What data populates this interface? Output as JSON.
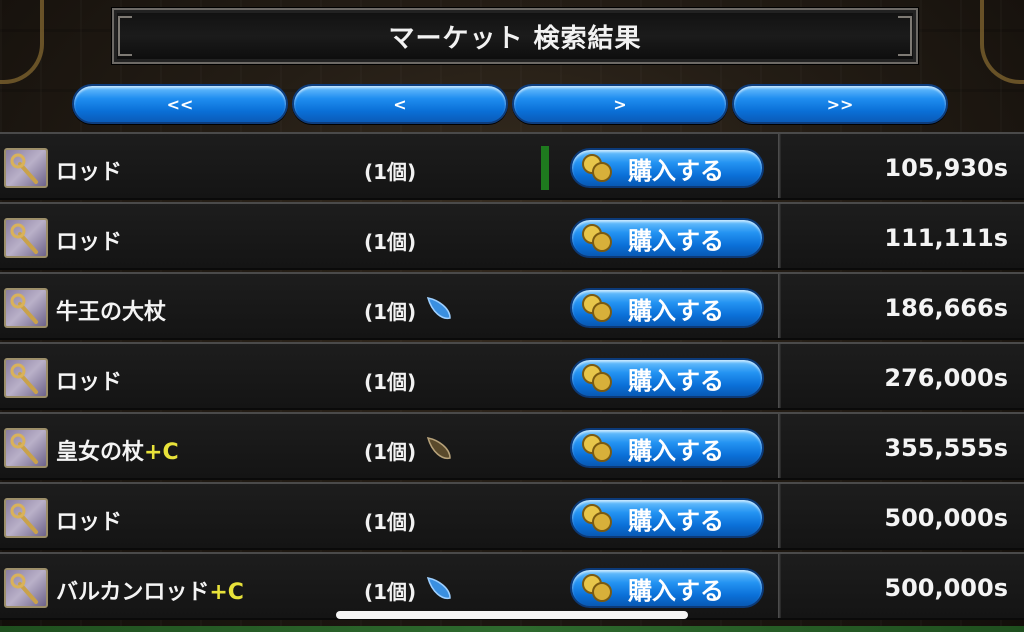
{
  "title": "マーケット 検索結果",
  "nav": {
    "first": "<<",
    "prev": "<",
    "next": ">",
    "last": ">>"
  },
  "items": [
    {
      "name": "ロッド",
      "plus": "",
      "qty": "(1個)",
      "gem": "",
      "buy_label": "購入する",
      "price": "105,930s"
    },
    {
      "name": "ロッド",
      "plus": "",
      "qty": "(1個)",
      "gem": "",
      "buy_label": "購入する",
      "price": "111,111s"
    },
    {
      "name": "牛王の大杖",
      "plus": "",
      "qty": "(1個)",
      "gem": "blue-gem-icon",
      "buy_label": "購入する",
      "price": "186,666s"
    },
    {
      "name": "ロッド",
      "plus": "",
      "qty": "(1個)",
      "gem": "",
      "buy_label": "購入する",
      "price": "276,000s"
    },
    {
      "name": "皇女の杖",
      "plus": "+C",
      "qty": "(1個)",
      "gem": "brown-gem-icon",
      "buy_label": "購入する",
      "price": "355,555s"
    },
    {
      "name": "ロッド",
      "plus": "",
      "qty": "(1個)",
      "gem": "",
      "buy_label": "購入する",
      "price": "500,000s"
    },
    {
      "name": "バルカンロッド",
      "plus": "+C",
      "qty": "(1個)",
      "gem": "blue-gem-icon",
      "buy_label": "購入する",
      "price": "500,000s"
    }
  ],
  "colors": {
    "button_blue": "#0b70d8",
    "plus_yellow": "#e8e23a",
    "gem_blue": "#3a8fe0",
    "gem_brown": "#5a4a2c"
  }
}
